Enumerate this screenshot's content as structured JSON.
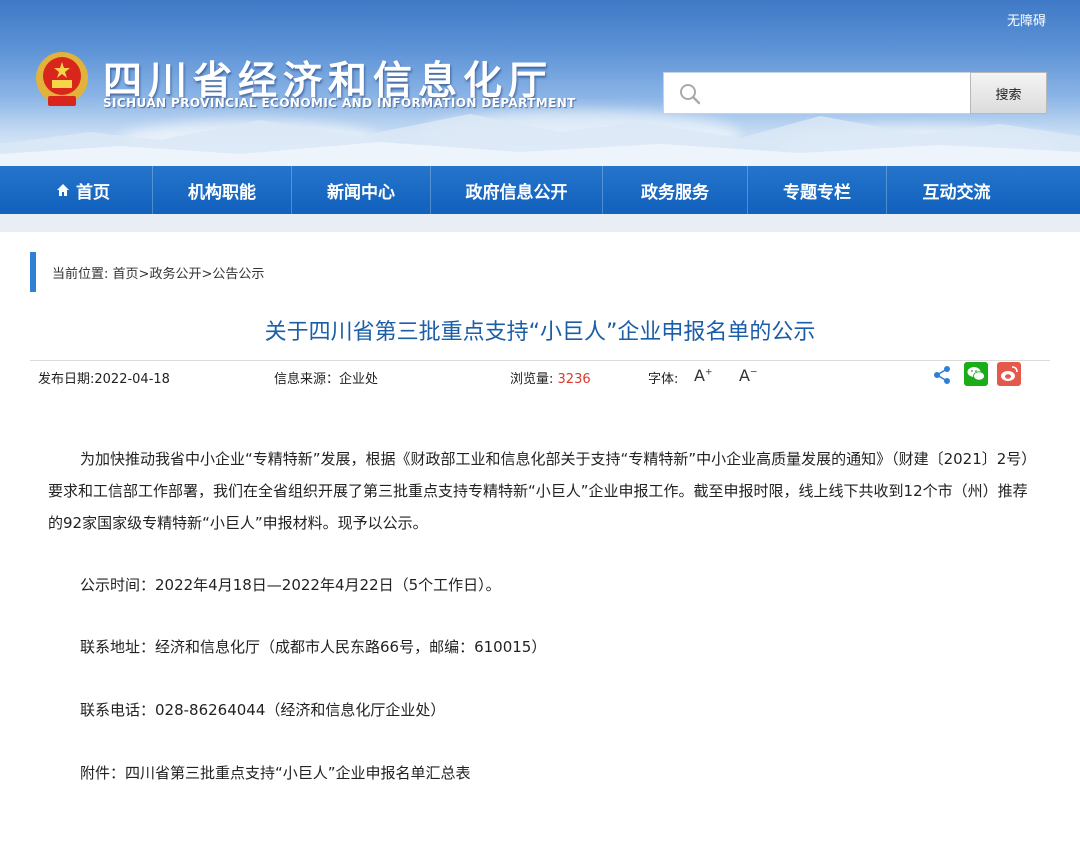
{
  "header": {
    "accessibility_link": "无障碍",
    "site_title": "四川省经济和信息化厅",
    "site_subtitle": "SICHUAN PROVINCIAL ECONOMIC AND INFORMATION DEPARTMENT",
    "search_placeholder": "",
    "search_button": "搜索"
  },
  "nav": {
    "items": [
      {
        "label": "首页",
        "icon": "home-icon"
      },
      {
        "label": "机构职能"
      },
      {
        "label": "新闻中心"
      },
      {
        "label": "政府信息公开"
      },
      {
        "label": "政务服务"
      },
      {
        "label": "专题专栏"
      },
      {
        "label": "互动交流"
      }
    ]
  },
  "breadcrumb": {
    "prefix": "当前位置:",
    "items": [
      "首页",
      "政务公开",
      "公告公示"
    ],
    "separator": ">"
  },
  "article": {
    "title": "关于四川省第三批重点支持“小巨人”企业申报名单的公示",
    "publish_date_label": "发布日期:",
    "publish_date": "2022-04-18",
    "source_label": "信息来源：",
    "source": "企业处",
    "views_label": "浏览量:",
    "views": "3236",
    "font_label": "字体:",
    "font_increase": "A",
    "font_decrease": "A",
    "paragraph1": "为加快推动我省中小企业“专精特新”发展，根据《财政部工业和信息化部关于支持“专精特新”中小企业高质量发展的通知》（财建〔2021〕2号）要求和工信部工作部署，我们在全省组织开展了第三批重点支持专精特新“小巨人”企业申报工作。截至申报时限，线上线下共收到12个市（州）推荐的92家国家级专精特新“小巨人”申报材料。现予以公示。",
    "publicity_period": "公示时间：2022年4月18日—2022年4月22日（5个工作日）。",
    "address": "联系地址：经济和信息化厅（成都市人民东路66号，邮编：610015）",
    "phone": "联系电话：028-86264044（经济和信息化厅企业处）",
    "attachment": "附件：四川省第三批重点支持“小巨人”企业申报名单汇总表"
  },
  "colors": {
    "nav_blue": "#1a6ac6",
    "title_blue": "#1a5ea8",
    "views_red": "#d93a2b",
    "wechat_green": "#1aad19",
    "weibo_red": "#e6594a"
  }
}
